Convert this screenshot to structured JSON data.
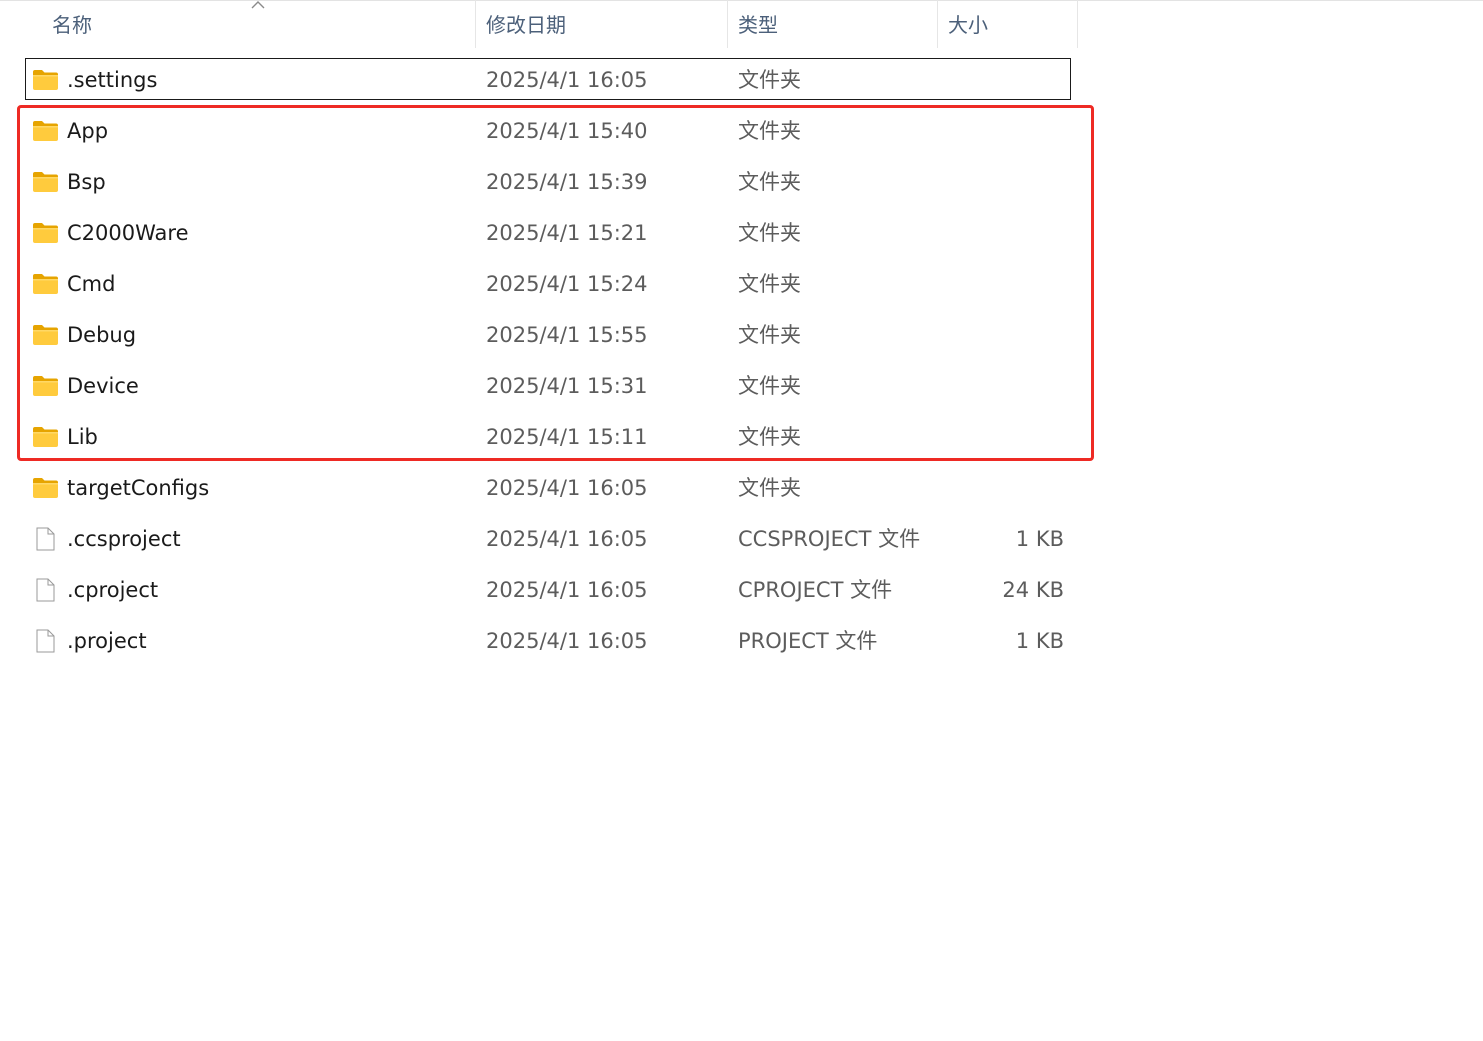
{
  "columns": {
    "name": "名称",
    "date": "修改日期",
    "type": "类型",
    "size": "大小"
  },
  "sort_indicator_icon": "chevron-up-icon",
  "highlight_color": "#ee2a24",
  "files": [
    {
      "name": ".settings",
      "date": "2025/4/1 16:05",
      "type": "文件夹",
      "size": "",
      "icon": "folder-icon",
      "selected": true
    },
    {
      "name": "App",
      "date": "2025/4/1 15:40",
      "type": "文件夹",
      "size": "",
      "icon": "folder-icon"
    },
    {
      "name": "Bsp",
      "date": "2025/4/1 15:39",
      "type": "文件夹",
      "size": "",
      "icon": "folder-icon"
    },
    {
      "name": "C2000Ware",
      "date": "2025/4/1 15:21",
      "type": "文件夹",
      "size": "",
      "icon": "folder-icon"
    },
    {
      "name": "Cmd",
      "date": "2025/4/1 15:24",
      "type": "文件夹",
      "size": "",
      "icon": "folder-icon"
    },
    {
      "name": "Debug",
      "date": "2025/4/1 15:55",
      "type": "文件夹",
      "size": "",
      "icon": "folder-icon"
    },
    {
      "name": "Device",
      "date": "2025/4/1 15:31",
      "type": "文件夹",
      "size": "",
      "icon": "folder-icon"
    },
    {
      "name": "Lib",
      "date": "2025/4/1 15:11",
      "type": "文件夹",
      "size": "",
      "icon": "folder-icon"
    },
    {
      "name": "targetConfigs",
      "date": "2025/4/1 16:05",
      "type": "文件夹",
      "size": "",
      "icon": "folder-icon"
    },
    {
      "name": ".ccsproject",
      "date": "2025/4/1 16:05",
      "type": "CCSPROJECT 文件",
      "size": "1 KB",
      "icon": "file-icon"
    },
    {
      "name": ".cproject",
      "date": "2025/4/1 16:05",
      "type": "CPROJECT 文件",
      "size": "24 KB",
      "icon": "file-icon"
    },
    {
      "name": ".project",
      "date": "2025/4/1 16:05",
      "type": "PROJECT 文件",
      "size": "1 KB",
      "icon": "file-icon"
    }
  ]
}
